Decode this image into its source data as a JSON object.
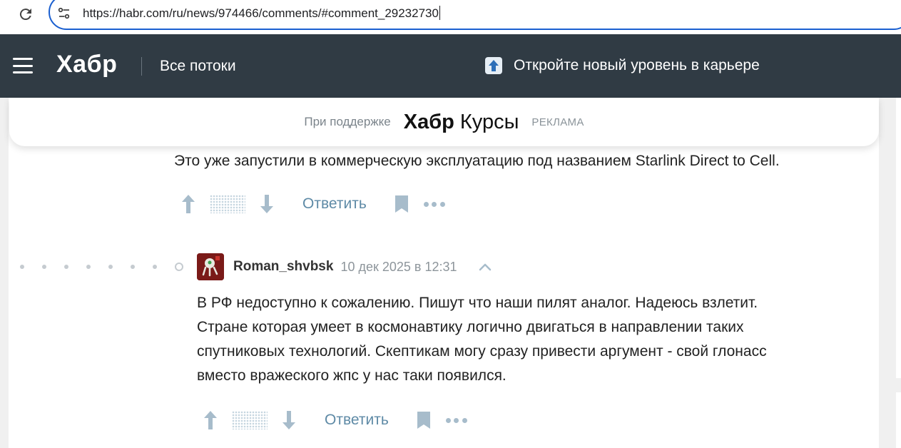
{
  "browser": {
    "url": "https://habr.com/ru/news/974466/comments/#comment_29232730"
  },
  "header": {
    "logo": "Хабр",
    "flows_link": "Все потоки",
    "promo_text": "Откройте новый уровень в карьере"
  },
  "sponsor": {
    "prefix": "При поддержке",
    "logo_part1": "Хабр",
    "logo_part2": "Курсы",
    "ad_label": "РЕКЛАМА"
  },
  "comments": [
    {
      "text": "Это уже запустили в коммерческую эксплуатацию под названием Starlink Direct to Cell.",
      "reply_label": "Ответить"
    },
    {
      "author": "Roman_shvbsk",
      "time": "10 дек 2025 в 12:31",
      "lines": [
        "В РФ недоступно к сожалению. Пишут что наши пилят аналог. Надеюсь взлетит.",
        "Стране которая умеет в космонавтику логично двигаться в направлении таких",
        "спутниковых технологий. Скептикам могу сразу привести аргумент - свой глонасс",
        "вместо вражеского жпс у нас таки появился."
      ],
      "reply_label": "Ответить"
    }
  ],
  "colors": {
    "header_bg": "#303b44",
    "accent_link": "#5e8aa6",
    "omnibox_border": "#1a5fd0"
  }
}
